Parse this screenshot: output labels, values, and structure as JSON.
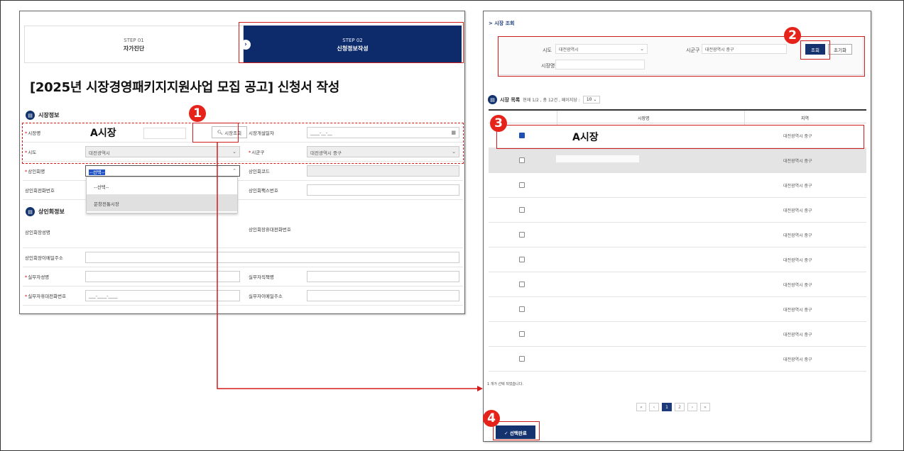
{
  "left": {
    "steps": [
      {
        "num": "STEP 01",
        "title": "자가진단"
      },
      {
        "num": "STEP 02",
        "title": "신청정보작성"
      }
    ],
    "page_title": "[2025년 시장경영패키지지원사업 모집 공고] 신청서 작성",
    "market_section": "시장정보",
    "fields": {
      "market_name_label": "시장명",
      "market_name_value": "A시장",
      "search_btn": "시장조회",
      "open_date_label": "시장개설일자",
      "open_date_value": "____-__-__",
      "sido_label": "시도",
      "sido_value": "대전광역시",
      "sigungu_label": "시군구",
      "sigungu_value": "대전광역시 중구",
      "merchant_assoc_label": "상인회명",
      "merchant_assoc_value": "--선택--",
      "merchant_code_label": "상인회코드",
      "merchant_phone_label": "상인회전화번호",
      "merchant_fax_label": "상인회팩스번호"
    },
    "dropdown_options": [
      "--선택--",
      "문창전통시장"
    ],
    "merchant_section": "상인회정보",
    "merchant_fields": {
      "head_name": "상인회장성명",
      "head_mobile": "상인회장휴대전화번호",
      "head_email": "상인회장이메일주소",
      "staff_name": "실무자성명",
      "staff_position": "실무자직책명",
      "staff_mobile": "실무자휴대전화번호",
      "staff_mobile_value": "___-____-____",
      "staff_email": "실무자이메일주소"
    }
  },
  "right": {
    "heading": "> 시장 조회",
    "filter": {
      "sido_label": "시도",
      "sido_value": "대전광역시",
      "sigungu_label": "시군구",
      "sigungu_value": "대전광역시 중구",
      "name_label": "시장명",
      "search_btn": "조회",
      "reset_btn": "초기화"
    },
    "list": {
      "title": "시장 목록",
      "summary": "현재 1/2 , 총 12건 , 페이지당 :",
      "per_page": "10",
      "col_name": "시장명",
      "col_region": "지역"
    },
    "rows": [
      {
        "name": "A시장",
        "region": "대전광역시 중구",
        "checked": true
      },
      {
        "name": "",
        "region": "대전광역시 중구",
        "checked": false
      },
      {
        "name": "",
        "region": "대전광역시 중구",
        "checked": false
      },
      {
        "name": "",
        "region": "대전광역시 중구",
        "checked": false
      },
      {
        "name": "",
        "region": "대전광역시 중구",
        "checked": false
      },
      {
        "name": "",
        "region": "대전광역시 중구",
        "checked": false
      },
      {
        "name": "",
        "region": "대전광역시 중구",
        "checked": false
      },
      {
        "name": "",
        "region": "대전광역시 중구",
        "checked": false
      },
      {
        "name": "",
        "region": "대전광역시 중구",
        "checked": false
      },
      {
        "name": "",
        "region": "대전광역시 중구",
        "checked": false
      }
    ],
    "selected_note": "1 개가 선택 되었습니다.",
    "pages": [
      "«",
      "‹",
      "1",
      "2",
      "›",
      "»"
    ],
    "current_page": "1",
    "done_btn": "✓ 선택완료"
  },
  "badges": [
    "1",
    "2",
    "3",
    "4"
  ],
  "colors": {
    "accent": "#e5231b",
    "navy": "#14336e"
  }
}
